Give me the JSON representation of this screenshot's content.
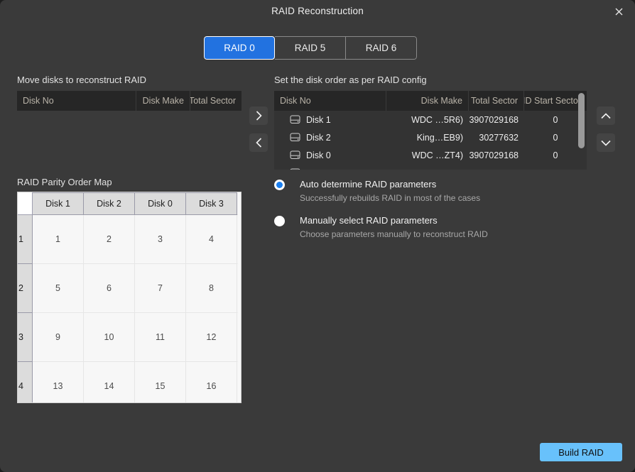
{
  "window": {
    "title": "RAID Reconstruction",
    "close_icon": "close-icon"
  },
  "raid_levels": {
    "selected": "RAID 0",
    "options": [
      "RAID 0",
      "RAID 5",
      "RAID 6"
    ]
  },
  "left_panel": {
    "label": "Move disks to reconstruct RAID",
    "columns": [
      "Disk No",
      "Disk Make",
      "Total Sector"
    ],
    "rows": []
  },
  "right_panel": {
    "label": "Set the disk order as per RAID config",
    "columns": [
      "Disk No",
      "Disk Make",
      "Total Sector",
      "RAID Start Sector"
    ],
    "rows": [
      {
        "disk_no": "Disk 1",
        "disk_make": "WDC …5R6)",
        "total_sector": "3907029168",
        "raid_start_sector": "0"
      },
      {
        "disk_no": "Disk 2",
        "disk_make": "King…EB9)",
        "total_sector": "30277632",
        "raid_start_sector": "0"
      },
      {
        "disk_no": "Disk 0",
        "disk_make": "WDC …ZT4)",
        "total_sector": "3907029168",
        "raid_start_sector": "0"
      }
    ]
  },
  "move_buttons": {
    "move_right_icon": "chevron-right-icon",
    "move_left_icon": "chevron-left-icon"
  },
  "order_buttons": {
    "up_icon": "chevron-up-icon",
    "down_icon": "chevron-down-icon"
  },
  "parameters": {
    "options": [
      {
        "title": "Auto determine RAID parameters",
        "subtitle": "Successfully rebuilds RAID in most of the cases",
        "selected": true
      },
      {
        "title": "Manually select RAID parameters",
        "subtitle": "Choose parameters manually to reconstruct RAID",
        "selected": false
      }
    ]
  },
  "parity_map": {
    "label": "RAID Parity Order Map",
    "columns": [
      "Disk 1",
      "Disk 2",
      "Disk 0",
      "Disk 3"
    ],
    "row_headers": [
      "1",
      "2",
      "3",
      "4"
    ],
    "rows": [
      [
        "1",
        "2",
        "3",
        "4"
      ],
      [
        "5",
        "6",
        "7",
        "8"
      ],
      [
        "9",
        "10",
        "11",
        "12"
      ],
      [
        "13",
        "14",
        "15",
        "16"
      ]
    ]
  },
  "footer": {
    "build_label": "Build RAID"
  },
  "colors": {
    "accent": "#2272e0",
    "build_button": "#68c1fb",
    "window_bg": "#3a3a3a",
    "radio_blue": "#1a7ff0"
  }
}
